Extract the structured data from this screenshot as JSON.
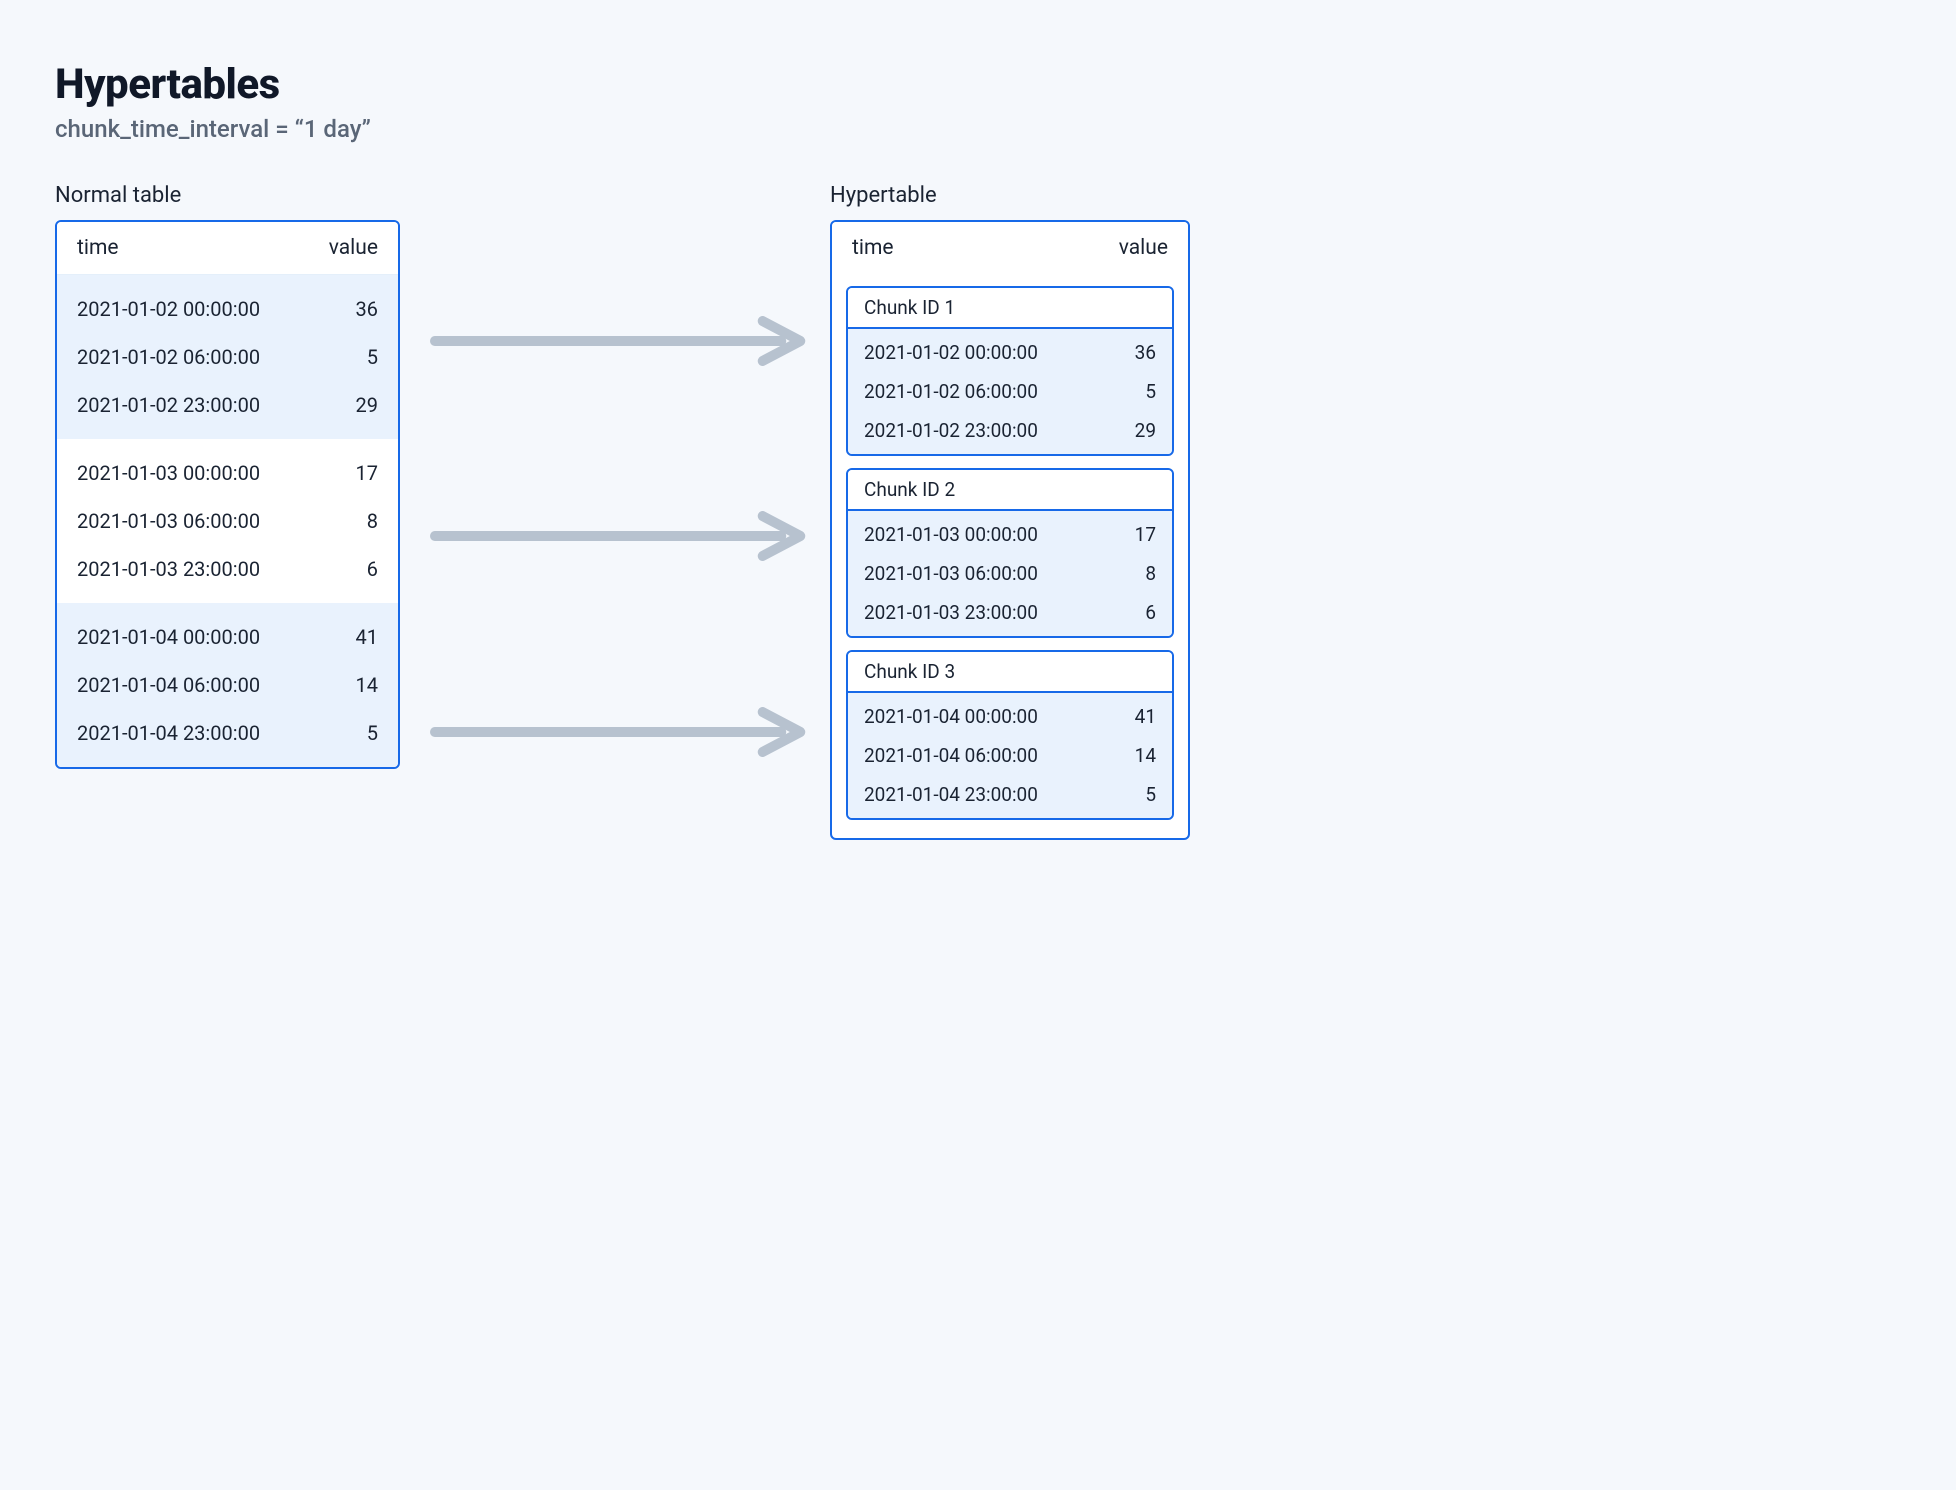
{
  "title": "Hypertables",
  "subtitle": "chunk_time_interval = “1 day”",
  "left_label": "Normal table",
  "right_label": "Hypertable",
  "columns": {
    "time": "time",
    "value": "value"
  },
  "groups": [
    {
      "tinted": true,
      "rows": [
        {
          "time": "2021-01-02 00:00:00",
          "value": "36"
        },
        {
          "time": "2021-01-02 06:00:00",
          "value": "5"
        },
        {
          "time": "2021-01-02 23:00:00",
          "value": "29"
        }
      ]
    },
    {
      "tinted": false,
      "rows": [
        {
          "time": "2021-01-03 00:00:00",
          "value": "17"
        },
        {
          "time": "2021-01-03 06:00:00",
          "value": "8"
        },
        {
          "time": "2021-01-03 23:00:00",
          "value": "6"
        }
      ]
    },
    {
      "tinted": true,
      "rows": [
        {
          "time": "2021-01-04 00:00:00",
          "value": "41"
        },
        {
          "time": "2021-01-04 06:00:00",
          "value": "14"
        },
        {
          "time": "2021-01-04 23:00:00",
          "value": "5"
        }
      ]
    }
  ],
  "chunks": [
    {
      "label": "Chunk ID 1",
      "rows": [
        {
          "time": "2021-01-02 00:00:00",
          "value": "36"
        },
        {
          "time": "2021-01-02 06:00:00",
          "value": "5"
        },
        {
          "time": "2021-01-02 23:00:00",
          "value": "29"
        }
      ]
    },
    {
      "label": "Chunk ID 2",
      "rows": [
        {
          "time": "2021-01-03 00:00:00",
          "value": "17"
        },
        {
          "time": "2021-01-03 06:00:00",
          "value": "8"
        },
        {
          "time": "2021-01-03 23:00:00",
          "value": "6"
        }
      ]
    },
    {
      "label": "Chunk ID 3",
      "rows": [
        {
          "time": "2021-01-04 00:00:00",
          "value": "41"
        },
        {
          "time": "2021-01-04 06:00:00",
          "value": "14"
        },
        {
          "time": "2021-01-04 23:00:00",
          "value": "5"
        }
      ]
    }
  ]
}
